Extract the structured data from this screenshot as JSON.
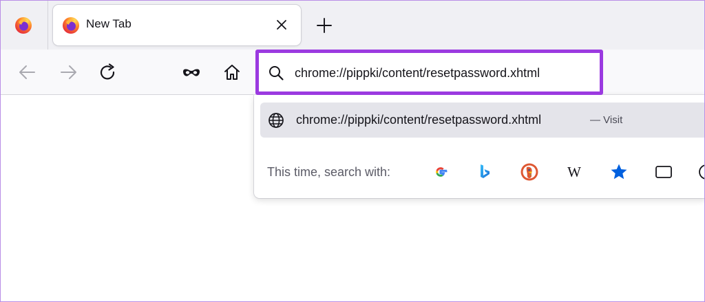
{
  "tabs": {
    "active": {
      "title": "New Tab",
      "icon": "firefox-logo-icon"
    },
    "close_icon": "close-icon",
    "new_tab_icon": "plus-icon"
  },
  "toolbar": {
    "icons": [
      "back-arrow-icon",
      "forward-arrow-icon",
      "reload-icon",
      "private-browsing-mask-icon",
      "home-icon"
    ]
  },
  "urlbar": {
    "value": "chrome://pippki/content/resetpassword.xhtml",
    "icon": "search-icon"
  },
  "suggestions": [
    {
      "url": "chrome://pippki/content/resetpassword.xhtml",
      "action": "— Visit",
      "icon": "globe-icon"
    }
  ],
  "search_with": {
    "label": "This time, search with:",
    "engines": [
      "Google",
      "Bing",
      "DuckDuckGo",
      "Wikipedia",
      "Bookmarks",
      "Tabs",
      "History"
    ]
  },
  "colors": {
    "highlight_border": "#9b3ae0",
    "tab_strip_bg": "#f0f0f4",
    "toolbar_bg": "#f9f9fb",
    "selected_row_bg": "#e4e4ea"
  }
}
